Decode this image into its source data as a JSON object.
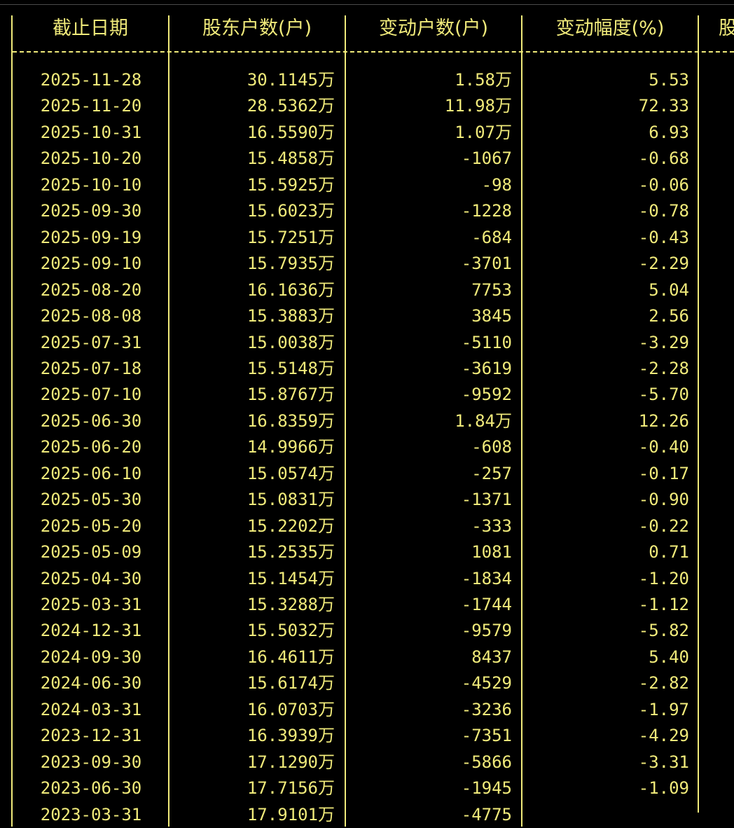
{
  "table": {
    "headers": [
      "截止日期",
      "股东户数(户)",
      "变动户数(户)",
      "变动幅度(%)",
      "股"
    ],
    "rows": [
      {
        "date": "2025-11-28",
        "holders": "30.1145万",
        "change": "1.58万",
        "pct": "5.53"
      },
      {
        "date": "2025-11-20",
        "holders": "28.5362万",
        "change": "11.98万",
        "pct": "72.33"
      },
      {
        "date": "2025-10-31",
        "holders": "16.5590万",
        "change": "1.07万",
        "pct": "6.93"
      },
      {
        "date": "2025-10-20",
        "holders": "15.4858万",
        "change": "-1067",
        "pct": "-0.68"
      },
      {
        "date": "2025-10-10",
        "holders": "15.5925万",
        "change": "-98",
        "pct": "-0.06"
      },
      {
        "date": "2025-09-30",
        "holders": "15.6023万",
        "change": "-1228",
        "pct": "-0.78"
      },
      {
        "date": "2025-09-19",
        "holders": "15.7251万",
        "change": "-684",
        "pct": "-0.43"
      },
      {
        "date": "2025-09-10",
        "holders": "15.7935万",
        "change": "-3701",
        "pct": "-2.29"
      },
      {
        "date": "2025-08-20",
        "holders": "16.1636万",
        "change": "7753",
        "pct": "5.04"
      },
      {
        "date": "2025-08-08",
        "holders": "15.3883万",
        "change": "3845",
        "pct": "2.56"
      },
      {
        "date": "2025-07-31",
        "holders": "15.0038万",
        "change": "-5110",
        "pct": "-3.29"
      },
      {
        "date": "2025-07-18",
        "holders": "15.5148万",
        "change": "-3619",
        "pct": "-2.28"
      },
      {
        "date": "2025-07-10",
        "holders": "15.8767万",
        "change": "-9592",
        "pct": "-5.70"
      },
      {
        "date": "2025-06-30",
        "holders": "16.8359万",
        "change": "1.84万",
        "pct": "12.26"
      },
      {
        "date": "2025-06-20",
        "holders": "14.9966万",
        "change": "-608",
        "pct": "-0.40"
      },
      {
        "date": "2025-06-10",
        "holders": "15.0574万",
        "change": "-257",
        "pct": "-0.17"
      },
      {
        "date": "2025-05-30",
        "holders": "15.0831万",
        "change": "-1371",
        "pct": "-0.90"
      },
      {
        "date": "2025-05-20",
        "holders": "15.2202万",
        "change": "-333",
        "pct": "-0.22"
      },
      {
        "date": "2025-05-09",
        "holders": "15.2535万",
        "change": "1081",
        "pct": "0.71"
      },
      {
        "date": "2025-04-30",
        "holders": "15.1454万",
        "change": "-1834",
        "pct": "-1.20"
      },
      {
        "date": "2025-03-31",
        "holders": "15.3288万",
        "change": "-1744",
        "pct": "-1.12"
      },
      {
        "date": "2024-12-31",
        "holders": "15.5032万",
        "change": "-9579",
        "pct": "-5.82"
      },
      {
        "date": "2024-09-30",
        "holders": "16.4611万",
        "change": "8437",
        "pct": "5.40"
      },
      {
        "date": "2024-06-30",
        "holders": "15.6174万",
        "change": "-4529",
        "pct": "-2.82"
      },
      {
        "date": "2024-03-31",
        "holders": "16.0703万",
        "change": "-3236",
        "pct": "-1.97"
      },
      {
        "date": "2023-12-31",
        "holders": "16.3939万",
        "change": "-7351",
        "pct": "-4.29"
      },
      {
        "date": "2023-09-30",
        "holders": "17.1290万",
        "change": "-5866",
        "pct": "-3.31"
      },
      {
        "date": "2023-06-30",
        "holders": "17.7156万",
        "change": "-1945",
        "pct": "-1.09"
      },
      {
        "date": "2023-03-31",
        "holders": "17.9101万",
        "change": "-4775",
        "pct": ""
      }
    ]
  },
  "colors": {
    "background": "#000000",
    "text": "#f0ea7a",
    "border": "#f0ea7a"
  }
}
